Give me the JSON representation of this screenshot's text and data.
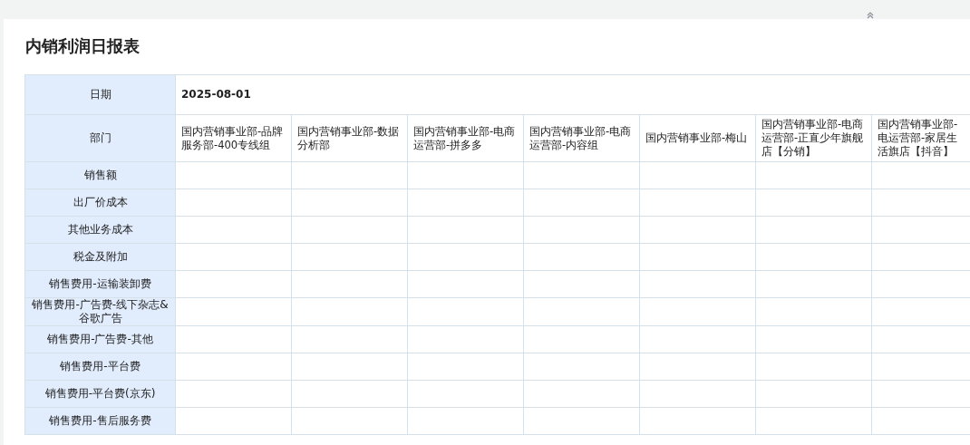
{
  "title": "内销利润日报表",
  "date_row": {
    "label": "日期",
    "value": "2025-08-01"
  },
  "department_row": {
    "label": "部门",
    "departments": [
      "国内营销事业部-品牌服务部-400专线组",
      "国内营销事业部-数据分析部",
      "国内营销事业部-电商运营部-拼多多",
      "国内营销事业部-电商运营部-内容组",
      "国内营销事业部-梅山",
      "国内营销事业部-电商运营部-正直少年旗舰店【分销】",
      "国内营销事业部-电运营部-家居生活旗店【抖音】"
    ]
  },
  "rows": [
    "销售额",
    "出厂价成本",
    "其他业务成本",
    "税金及附加",
    "销售费用-运输装卸费",
    "销售费用-广告费-线下杂志&谷歌广告",
    "销售费用-广告费-其他",
    "销售费用-平台费",
    "销售费用-平台费(京东)",
    "销售费用-售后服务费"
  ]
}
